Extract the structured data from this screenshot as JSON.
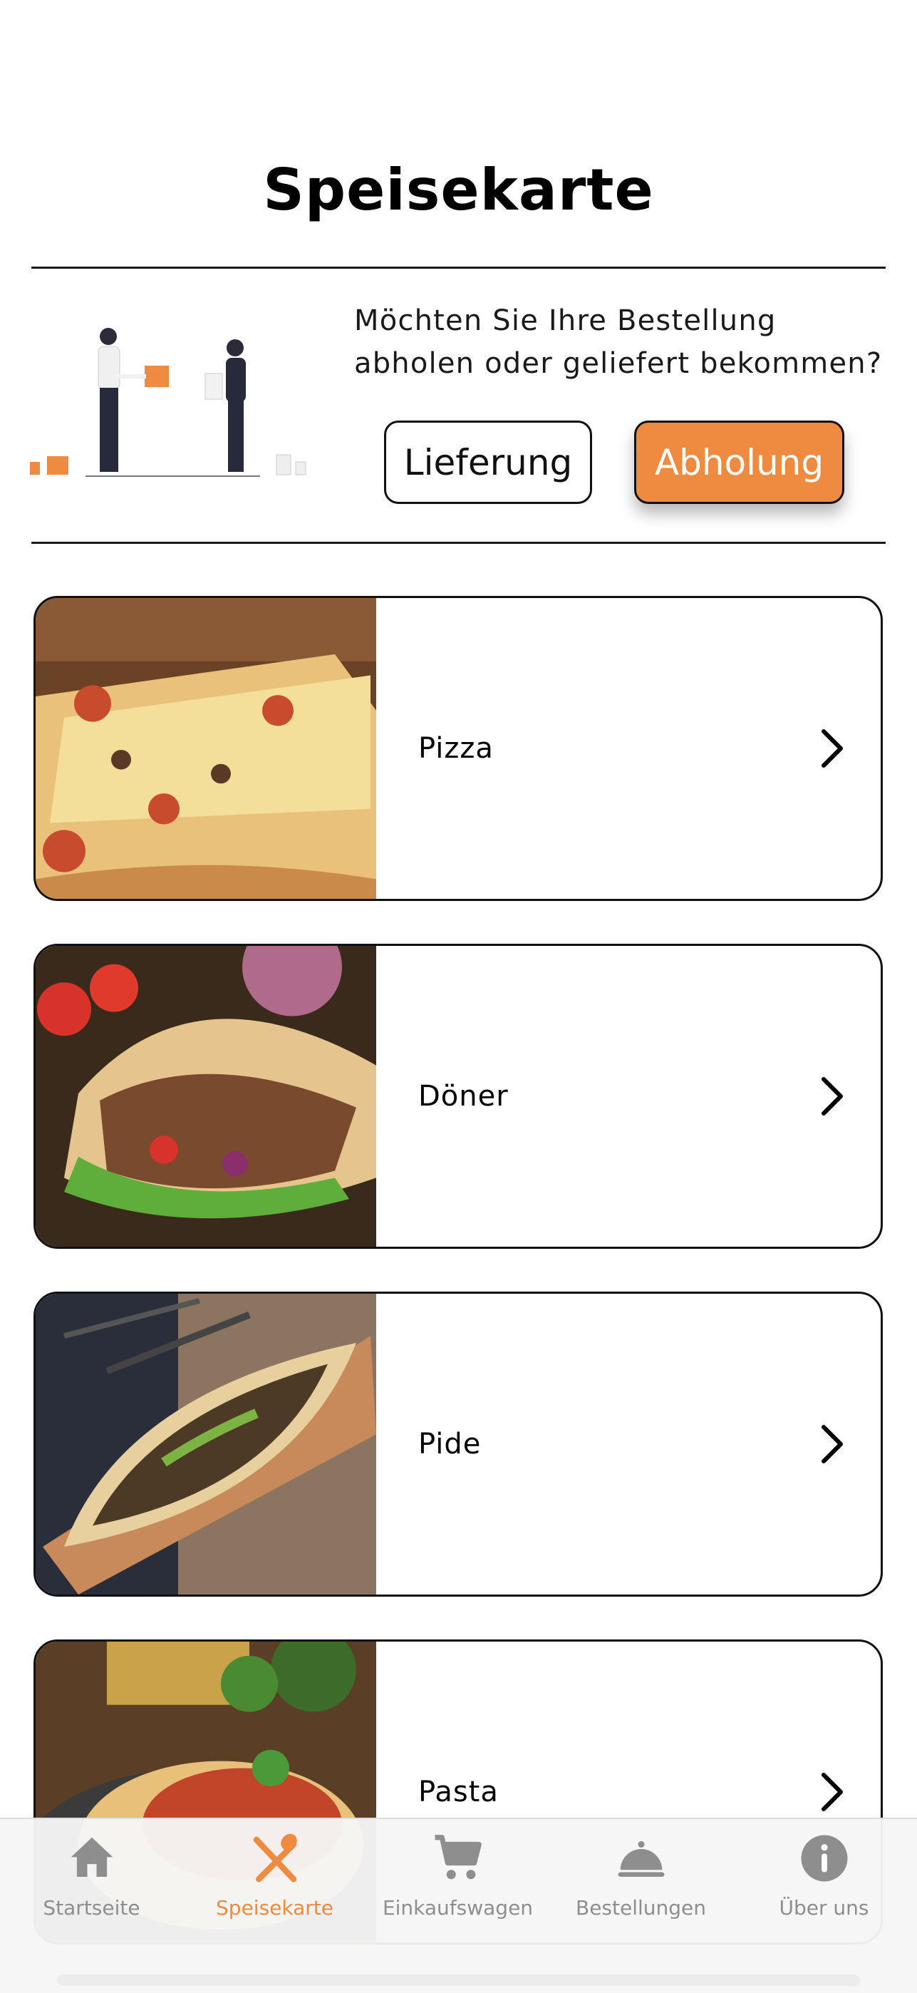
{
  "header": {
    "title": "Speisekarte"
  },
  "order_mode": {
    "question": "Möchten Sie Ihre Bestellung abholen oder geliefert bekommen?",
    "delivery_label": "Lieferung",
    "pickup_label": "Abholung",
    "selected": "Abholung"
  },
  "categories": [
    {
      "label": "Pizza",
      "icon": "chevron-right-icon"
    },
    {
      "label": "Döner",
      "icon": "chevron-right-icon"
    },
    {
      "label": "Pide",
      "icon": "chevron-right-icon"
    },
    {
      "label": "Pasta",
      "icon": "chevron-right-icon"
    }
  ],
  "tab_bar": {
    "items": [
      {
        "label": "Startseite",
        "icon": "home-icon"
      },
      {
        "label": "Speisekarte",
        "icon": "utensils-icon",
        "active": true
      },
      {
        "label": "Einkaufswagen",
        "icon": "cart-icon"
      },
      {
        "label": "Bestellungen",
        "icon": "cloche-icon"
      },
      {
        "label": "Über uns",
        "icon": "info-icon"
      }
    ]
  },
  "colors": {
    "accent": "#ef8a41",
    "inactive": "#8e8e8e",
    "border": "#111111"
  }
}
